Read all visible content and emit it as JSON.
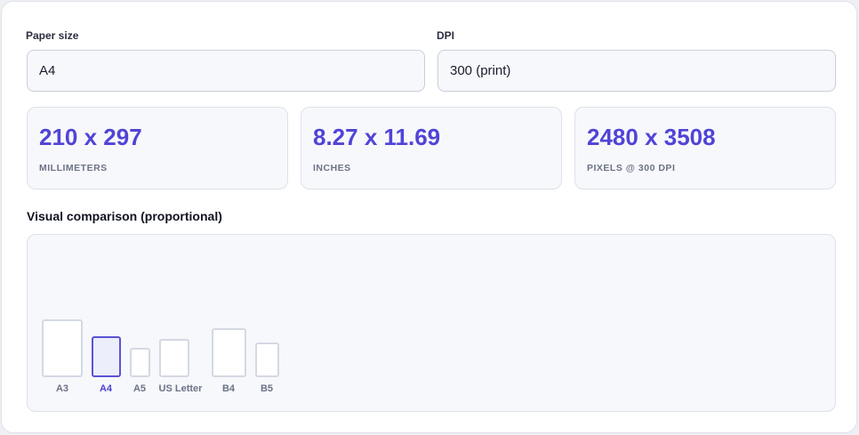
{
  "paper_size": {
    "label": "Paper size",
    "value": "A4"
  },
  "dpi": {
    "label": "DPI",
    "value": "300 (print)"
  },
  "stats": [
    {
      "value": "210 x 297",
      "caption": "MILLIMETERS"
    },
    {
      "value": "8.27 x 11.69",
      "caption": "INCHES"
    },
    {
      "value": "2480 x 3508",
      "caption": "PIXELS @ 300 DPI"
    }
  ],
  "comparison": {
    "title": "Visual comparison (proportional)",
    "papers": [
      {
        "name": "A3",
        "selected": false
      },
      {
        "name": "A4",
        "selected": true
      },
      {
        "name": "A5",
        "selected": false
      },
      {
        "name": "US Letter",
        "selected": false
      },
      {
        "name": "B4",
        "selected": false
      },
      {
        "name": "B5",
        "selected": false
      }
    ]
  },
  "colors": {
    "accent": "#5044d6",
    "selected_border": "#5a52d6",
    "selected_fill": "#eceefb"
  }
}
